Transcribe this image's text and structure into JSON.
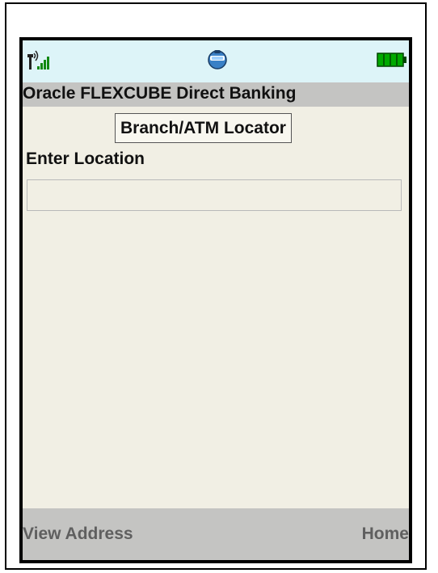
{
  "status_bar": {
    "signal_icon": "signal-strength-icon",
    "center_icon": "app-status-icon",
    "battery_icon": "battery-icon"
  },
  "app": {
    "title": "Oracle FLEXCUBE Direct Banking"
  },
  "screen": {
    "heading": "Branch/ATM Locator",
    "location_label": "Enter Location",
    "location_value": ""
  },
  "softkeys": {
    "left_label": "View Address",
    "right_label": "Home"
  },
  "colors": {
    "status_bar_bg": "#ddf4f8",
    "title_bar_bg": "#c4c4c2",
    "screen_bg": "#f1efe4",
    "softkey_text": "#5f5f5f",
    "battery_green": "#00aa00"
  }
}
